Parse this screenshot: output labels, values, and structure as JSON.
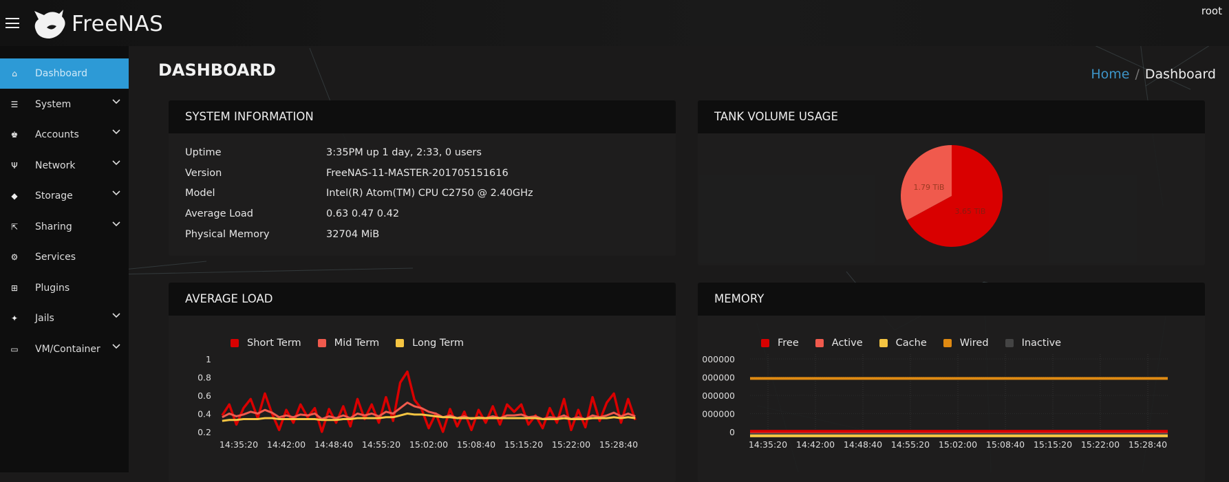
{
  "header": {
    "app_name": "FreeNAS",
    "user": "root"
  },
  "sidebar": {
    "items": [
      {
        "label": "Dashboard",
        "icon": "home-icon",
        "glyph": "⌂",
        "active": true,
        "expandable": false
      },
      {
        "label": "System",
        "icon": "sliders-icon",
        "glyph": "☰",
        "expandable": true
      },
      {
        "label": "Accounts",
        "icon": "users-icon",
        "glyph": "♚",
        "expandable": true
      },
      {
        "label": "Network",
        "icon": "network-icon",
        "glyph": "Ψ",
        "expandable": true
      },
      {
        "label": "Storage",
        "icon": "cube-icon",
        "glyph": "◆",
        "expandable": true
      },
      {
        "label": "Sharing",
        "icon": "share-icon",
        "glyph": "⇱",
        "expandable": true
      },
      {
        "label": "Services",
        "icon": "gear-icon",
        "glyph": "⚙",
        "expandable": false
      },
      {
        "label": "Plugins",
        "icon": "grid-icon",
        "glyph": "⊞",
        "expandable": false
      },
      {
        "label": "Jails",
        "icon": "jail-icon",
        "glyph": "✦",
        "expandable": true
      },
      {
        "label": "VM/Container",
        "icon": "monitor-icon",
        "glyph": "▭",
        "expandable": true
      }
    ]
  },
  "page": {
    "title": "DASHBOARD",
    "breadcrumb": {
      "home": "Home",
      "separator": "/",
      "current": "Dashboard"
    }
  },
  "system_info": {
    "title": "SYSTEM INFORMATION",
    "rows": [
      {
        "label": "Uptime",
        "value": "3:35PM up 1 day, 2:33, 0 users"
      },
      {
        "label": "Version",
        "value": "FreeNAS-11-MASTER-201705151616"
      },
      {
        "label": "Model",
        "value": "Intel(R) Atom(TM) CPU C2750 @ 2.40GHz"
      },
      {
        "label": "Average Load",
        "value": "0.63 0.47 0.42"
      },
      {
        "label": "Physical Memory",
        "value": "32704 MiB"
      }
    ]
  },
  "tank": {
    "title": "TANK VOLUME USAGE"
  },
  "avg_load": {
    "title": "AVERAGE LOAD"
  },
  "memory": {
    "title": "MEMORY"
  },
  "colors": {
    "accent": "#2d9ad6",
    "red": "#d90000",
    "salmon": "#f05a4d",
    "yellow": "#f5c542",
    "orange": "#df8a12",
    "gray": "#444444"
  },
  "chart_data": [
    {
      "type": "pie",
      "title": "TANK VOLUME USAGE",
      "slices": [
        {
          "label": "1.79 TiB",
          "value": 1.79,
          "color": "#f05a4d"
        },
        {
          "label": "3.65 TiB",
          "value": 3.65,
          "color": "#d90000"
        }
      ]
    },
    {
      "type": "line",
      "title": "AVERAGE LOAD",
      "legend": "top",
      "grid": false,
      "ylim": [
        0.17,
        1.05
      ],
      "yticks": [
        1,
        0.8,
        0.6,
        0.4,
        0.2
      ],
      "xticks": [
        "14:35:20",
        "14:42:00",
        "14:48:40",
        "14:55:20",
        "15:02:00",
        "15:08:40",
        "15:15:20",
        "15:22:00",
        "15:28:40"
      ],
      "x": [
        "14:33:00",
        "14:34:00",
        "14:35:00",
        "14:36:00",
        "14:37:00",
        "14:38:00",
        "14:39:00",
        "14:40:00",
        "14:41:00",
        "14:42:00",
        "14:43:00",
        "14:44:00",
        "14:45:00",
        "14:46:00",
        "14:47:00",
        "14:48:00",
        "14:49:00",
        "14:50:00",
        "14:51:00",
        "14:52:00",
        "14:53:00",
        "14:54:00",
        "14:55:00",
        "14:56:00",
        "14:57:00",
        "14:58:00",
        "14:59:00",
        "15:00:00",
        "15:01:00",
        "15:02:00",
        "15:03:00",
        "15:04:00",
        "15:05:00",
        "15:06:00",
        "15:07:00",
        "15:08:00",
        "15:09:00",
        "15:10:00",
        "15:11:00",
        "15:12:00",
        "15:13:00",
        "15:14:00",
        "15:15:00",
        "15:16:00",
        "15:17:00",
        "15:18:00",
        "15:19:00",
        "15:20:00",
        "15:21:00",
        "15:22:00",
        "15:23:00",
        "15:24:00",
        "15:25:00",
        "15:26:00",
        "15:27:00",
        "15:28:00",
        "15:29:00",
        "15:30:00",
        "15:31:00"
      ],
      "series": [
        {
          "name": "Short Term",
          "color": "#d90000",
          "values": [
            0.38,
            0.5,
            0.28,
            0.46,
            0.56,
            0.35,
            0.62,
            0.4,
            0.22,
            0.44,
            0.3,
            0.5,
            0.36,
            0.46,
            0.2,
            0.45,
            0.3,
            0.48,
            0.26,
            0.56,
            0.34,
            0.5,
            0.3,
            0.58,
            0.32,
            0.74,
            0.86,
            0.55,
            0.45,
            0.24,
            0.4,
            0.2,
            0.45,
            0.26,
            0.42,
            0.22,
            0.44,
            0.3,
            0.48,
            0.28,
            0.5,
            0.42,
            0.5,
            0.28,
            0.38,
            0.24,
            0.46,
            0.3,
            0.56,
            0.22,
            0.44,
            0.25,
            0.58,
            0.32,
            0.52,
            0.62,
            0.3,
            0.56,
            0.33
          ]
        },
        {
          "name": "Mid Term",
          "color": "#f05a4d",
          "values": [
            0.36,
            0.4,
            0.37,
            0.39,
            0.42,
            0.4,
            0.44,
            0.41,
            0.36,
            0.38,
            0.36,
            0.39,
            0.38,
            0.4,
            0.34,
            0.37,
            0.35,
            0.38,
            0.35,
            0.4,
            0.38,
            0.4,
            0.37,
            0.42,
            0.4,
            0.46,
            0.52,
            0.48,
            0.46,
            0.42,
            0.4,
            0.36,
            0.38,
            0.35,
            0.37,
            0.34,
            0.36,
            0.35,
            0.37,
            0.35,
            0.38,
            0.38,
            0.39,
            0.36,
            0.37,
            0.34,
            0.36,
            0.35,
            0.38,
            0.34,
            0.36,
            0.34,
            0.38,
            0.36,
            0.38,
            0.41,
            0.37,
            0.4,
            0.37
          ]
        },
        {
          "name": "Long Term",
          "color": "#f5c542",
          "values": [
            0.32,
            0.33,
            0.33,
            0.34,
            0.34,
            0.34,
            0.35,
            0.35,
            0.34,
            0.34,
            0.34,
            0.34,
            0.34,
            0.34,
            0.33,
            0.33,
            0.33,
            0.34,
            0.34,
            0.35,
            0.35,
            0.35,
            0.35,
            0.36,
            0.36,
            0.38,
            0.4,
            0.39,
            0.39,
            0.38,
            0.37,
            0.36,
            0.36,
            0.35,
            0.35,
            0.35,
            0.35,
            0.35,
            0.35,
            0.35,
            0.35,
            0.35,
            0.35,
            0.35,
            0.35,
            0.34,
            0.34,
            0.34,
            0.35,
            0.34,
            0.34,
            0.34,
            0.35,
            0.35,
            0.35,
            0.36,
            0.35,
            0.36,
            0.35
          ]
        }
      ]
    },
    {
      "type": "line",
      "title": "MEMORY",
      "legend": "top",
      "grid": true,
      "ylim": [
        -0.3,
        4.2
      ],
      "yticks": [
        4,
        3,
        2,
        1,
        0
      ],
      "ytick_labels": [
        "000000",
        "000000",
        "000000",
        "000000",
        "0"
      ],
      "xticks": [
        "14:35:20",
        "14:42:00",
        "14:48:40",
        "14:55:20",
        "15:02:00",
        "15:08:40",
        "15:15:20",
        "15:22:00",
        "15:28:40"
      ],
      "x": [
        "14:33:00",
        "15:31:00"
      ],
      "series": [
        {
          "name": "Free",
          "color": "#d90000",
          "values": [
            0.03,
            0.03
          ]
        },
        {
          "name": "Active",
          "color": "#f05a4d",
          "values": [
            0.01,
            0.01
          ]
        },
        {
          "name": "Cache",
          "color": "#f5c542",
          "values": [
            -0.22,
            -0.22
          ]
        },
        {
          "name": "Wired",
          "color": "#df8a12",
          "values": [
            2.93,
            2.93
          ]
        },
        {
          "name": "Inactive",
          "color": "#444444",
          "values": [
            -0.1,
            -0.1
          ]
        }
      ]
    }
  ]
}
